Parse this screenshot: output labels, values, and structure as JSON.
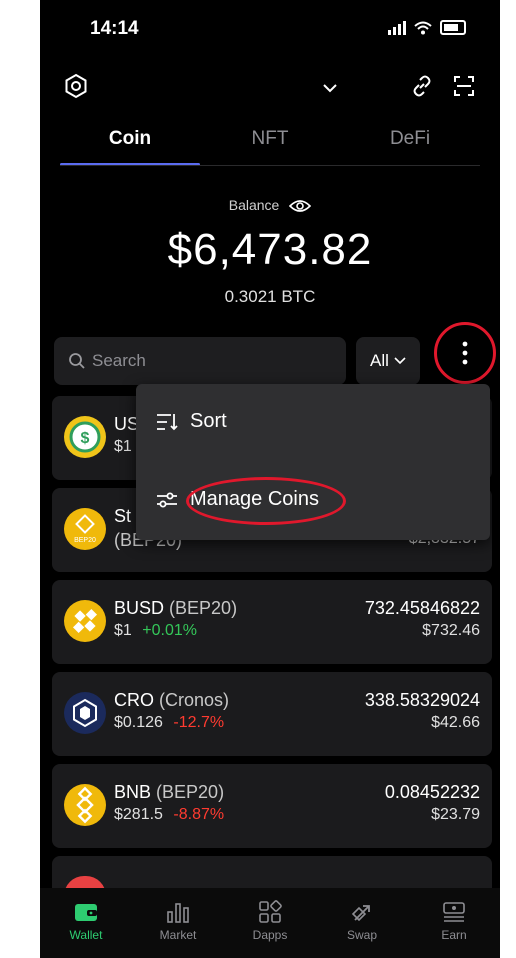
{
  "status_bar": {
    "time": "14:14"
  },
  "tabs": [
    {
      "label": "Coin",
      "active": true
    },
    {
      "label": "NFT",
      "active": false
    },
    {
      "label": "DeFi",
      "active": false
    }
  ],
  "balance": {
    "label": "Balance",
    "value": "$6,473.82",
    "btc": "0.3021 BTC"
  },
  "search": {
    "placeholder": "Search"
  },
  "filter": {
    "label": "All"
  },
  "menu": {
    "items": [
      {
        "label": "Sort",
        "icon": "sort-icon"
      },
      {
        "label": "Manage Coins",
        "icon": "sliders-icon"
      }
    ]
  },
  "coins": [
    {
      "name": "US",
      "chain": "",
      "price": "$1",
      "change": "",
      "amount": "",
      "fiat": "",
      "logo_color": "#f0c419"
    },
    {
      "name": "St",
      "chain": "(BEP20)",
      "price": "",
      "change": "",
      "amount": "",
      "fiat": "$2,832.57",
      "logo_color": "#f0b90b"
    },
    {
      "name": "BUSD",
      "chain": "(BEP20)",
      "price": "$1",
      "change": "+0.01%",
      "change_dir": "pos",
      "amount": "732.45846822",
      "fiat": "$732.46",
      "logo_color": "#f0b90b"
    },
    {
      "name": "CRO",
      "chain": "(Cronos)",
      "price": "$0.126",
      "change": "-12.7%",
      "change_dir": "neg",
      "amount": "338.58329024",
      "fiat": "$42.66",
      "logo_color": "#1b2a5c"
    },
    {
      "name": "BNB",
      "chain": "(BEP20)",
      "price": "$281.5",
      "change": "-8.87%",
      "change_dir": "neg",
      "amount": "0.08452232",
      "fiat": "$23.79",
      "logo_color": "#f0b90b"
    }
  ],
  "bottom_nav": [
    {
      "label": "Wallet",
      "active": true
    },
    {
      "label": "Market",
      "active": false
    },
    {
      "label": "Dapps",
      "active": false
    },
    {
      "label": "Swap",
      "active": false
    },
    {
      "label": "Earn",
      "active": false
    }
  ],
  "colors": {
    "accent": "#5b6cf0",
    "positive": "#34c759",
    "negative": "#ff3b30",
    "highlight": "#e0182c",
    "nav_active": "#2ecc71"
  }
}
